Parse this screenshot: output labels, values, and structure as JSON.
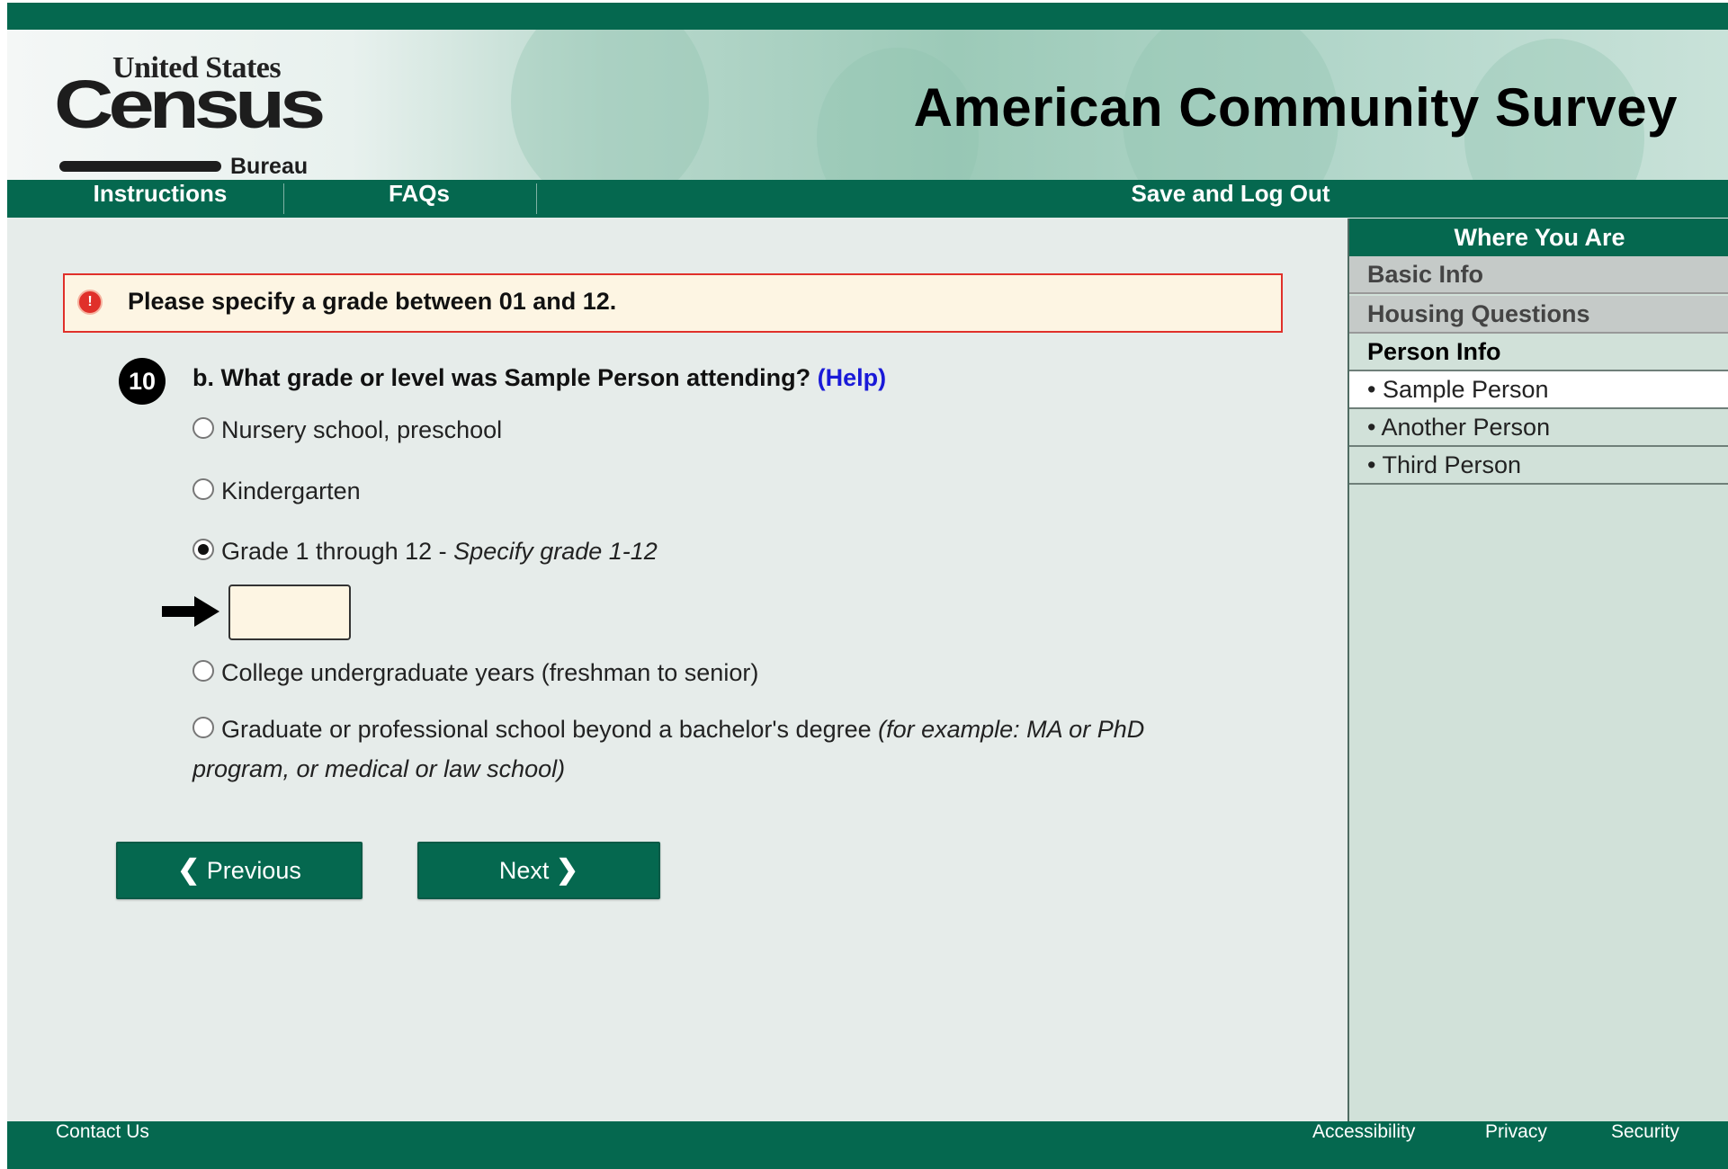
{
  "header": {
    "logo": {
      "top": "United States",
      "main": "Census",
      "bottom": "Bureau"
    },
    "title": "American Community Survey"
  },
  "nav": {
    "instructions": "Instructions",
    "faqs": "FAQs",
    "save_logout": "Save and Log Out"
  },
  "error": {
    "icon": "error-exclamation-icon",
    "message": "Please specify a grade between 01 and 12."
  },
  "question": {
    "number": "10",
    "text": "b. What grade or level was Sample Person attending?",
    "help": "(Help)",
    "options": [
      {
        "label": "Nursery school, preschool",
        "checked": false
      },
      {
        "label": "Kindergarten",
        "checked": false
      },
      {
        "label": "Grade 1 through 12 - ",
        "note": "Specify grade 1-12",
        "checked": true
      },
      {
        "label": "College undergraduate years (freshman to senior)",
        "checked": false
      },
      {
        "label": "Graduate or professional school beyond a bachelor's degree ",
        "note": "(for example: MA or PhD program, or medical or law school)",
        "checked": false
      }
    ],
    "grade_value": ""
  },
  "buttons": {
    "previous": "Previous",
    "next": "Next"
  },
  "sidebar": {
    "title": "Where You Are",
    "items": [
      {
        "label": "Basic Info"
      },
      {
        "label": "Housing Questions"
      },
      {
        "label": "Person Info"
      },
      {
        "label": "• Sample Person"
      },
      {
        "label": "• Another Person"
      },
      {
        "label": "• Third Person"
      }
    ]
  },
  "footer": {
    "contact": "Contact Us",
    "accessibility": "Accessibility",
    "privacy": "Privacy",
    "security": "Security"
  },
  "colors": {
    "brand_green": "#05684f",
    "error_red": "#e0302a",
    "input_bg": "#fdf5e3",
    "link_blue": "#1a1ad8"
  }
}
